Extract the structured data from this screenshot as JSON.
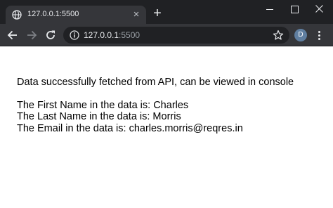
{
  "tab": {
    "title": "127.0.0.1:5500",
    "favicon": "globe-icon",
    "close": "×"
  },
  "new_tab": "+",
  "address_bar": {
    "host": "127.0.0.1",
    "port": ":5500"
  },
  "profile": {
    "initial": "D"
  },
  "page": {
    "status_message": "Data successfully fetched from API, can be viewed in console",
    "first_name_line": "The First Name in the data is: Charles",
    "last_name_line": "The Last Name in the data is: Morris",
    "email_line": "The Email in the data is: charles.morris@reqres.in"
  },
  "colors": {
    "frame": "#202124",
    "toolbar": "#35363a",
    "avatar": "#5f7ea0",
    "page_background": "#ffffff",
    "text": "#000000"
  }
}
